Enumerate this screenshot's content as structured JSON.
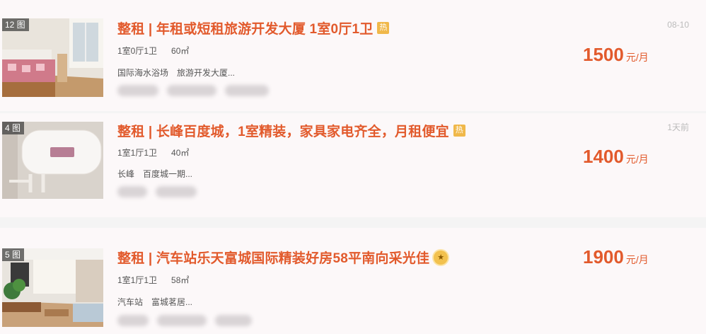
{
  "colors": {
    "accent": "#e25a2c",
    "badge": "#f0b84a",
    "card_bg": "#fcf8f9"
  },
  "listings": [
    {
      "photo_count": "12 图",
      "title": "整租 | 年租或短租旅游开发大厦 1室0厅1卫",
      "badge": "热",
      "layout": "1室0厅1卫",
      "area": "60㎡",
      "district": "国际海水浴场",
      "community": "旅游开发大厦...",
      "price": "1500",
      "price_unit": "元/月",
      "date": "08-10"
    },
    {
      "photo_count": "4 图",
      "title": "整租 | 长峰百度城，1室精装，家具家电齐全，月租便宜",
      "badge": "热",
      "layout": "1室1厅1卫",
      "area": "40㎡",
      "district": "长峰",
      "community": "百度城一期...",
      "price": "1400",
      "price_unit": "元/月",
      "date": "1天前"
    },
    {
      "photo_count": "5 图",
      "title": "整租 | 汽车站乐天富城国际精装好房58平南向采光佳",
      "medal_icon": "medal-icon",
      "layout": "1室1厅1卫",
      "area": "58㎡",
      "district": "汽车站",
      "community": "富城茗居...",
      "price": "1900",
      "price_unit": "元/月"
    }
  ]
}
